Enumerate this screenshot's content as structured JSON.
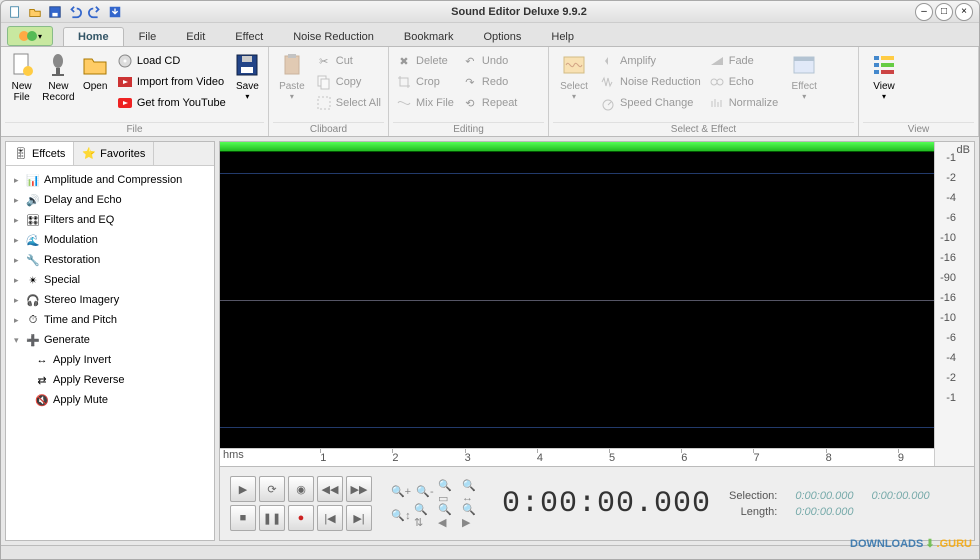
{
  "window": {
    "title": "Sound Editor Deluxe 9.9.2"
  },
  "tabs": [
    "Home",
    "File",
    "Edit",
    "Effect",
    "Noise Reduction",
    "Bookmark",
    "Options",
    "Help"
  ],
  "active_tab": "Home",
  "ribbon": {
    "file": {
      "label": "File",
      "new_file": "New\nFile",
      "new_record": "New\nRecord",
      "open": "Open",
      "load_cd": "Load CD",
      "import_video": "Import from Video",
      "get_youtube": "Get from YouTube",
      "save": "Save"
    },
    "clipboard": {
      "label": "Cliboard",
      "paste": "Paste",
      "cut": "Cut",
      "copy": "Copy",
      "select_all": "Select All"
    },
    "editing": {
      "label": "Editing",
      "delete": "Delete",
      "crop": "Crop",
      "mix_file": "Mix File",
      "undo": "Undo",
      "redo": "Redo",
      "repeat": "Repeat"
    },
    "select_effect": {
      "label": "Select & Effect",
      "select": "Select",
      "amplify": "Amplify",
      "noise_reduction": "Noise Reduction",
      "speed_change": "Speed Change",
      "fade": "Fade",
      "echo": "Echo",
      "normalize": "Normalize",
      "effect": "Effect"
    },
    "view": {
      "label": "View",
      "view": "View"
    }
  },
  "sidebar": {
    "tabs": {
      "effects": "Effcets",
      "favorites": "Favorites"
    },
    "active": "effects",
    "items": [
      {
        "label": "Amplitude and Compression"
      },
      {
        "label": "Delay and Echo"
      },
      {
        "label": "Filters and EQ"
      },
      {
        "label": "Modulation"
      },
      {
        "label": "Restoration"
      },
      {
        "label": "Special"
      },
      {
        "label": "Stereo Imagery"
      },
      {
        "label": "Time and Pitch"
      },
      {
        "label": "Generate"
      }
    ],
    "children": [
      {
        "label": "Apply Invert"
      },
      {
        "label": "Apply Reverse"
      },
      {
        "label": "Apply Mute"
      }
    ]
  },
  "db_scale": {
    "unit": "dB",
    "marks": [
      "-1",
      "-2",
      "-4",
      "-6",
      "-10",
      "-16",
      "-90",
      "-16",
      "-10",
      "-6",
      "-4",
      "-2",
      "-1"
    ]
  },
  "ruler": {
    "unit": "hms",
    "ticks": [
      "1",
      "2",
      "3",
      "4",
      "5",
      "6",
      "7",
      "8",
      "9"
    ]
  },
  "timecode": "0:00:00.000",
  "selection": {
    "sel_label": "Selection:",
    "len_label": "Length:",
    "start": "0:00:00.000",
    "end": "0:00:00.000",
    "length": "0:00:00.000"
  },
  "watermark": {
    "a": "DOWNLOADS",
    "b": ".GURU"
  }
}
